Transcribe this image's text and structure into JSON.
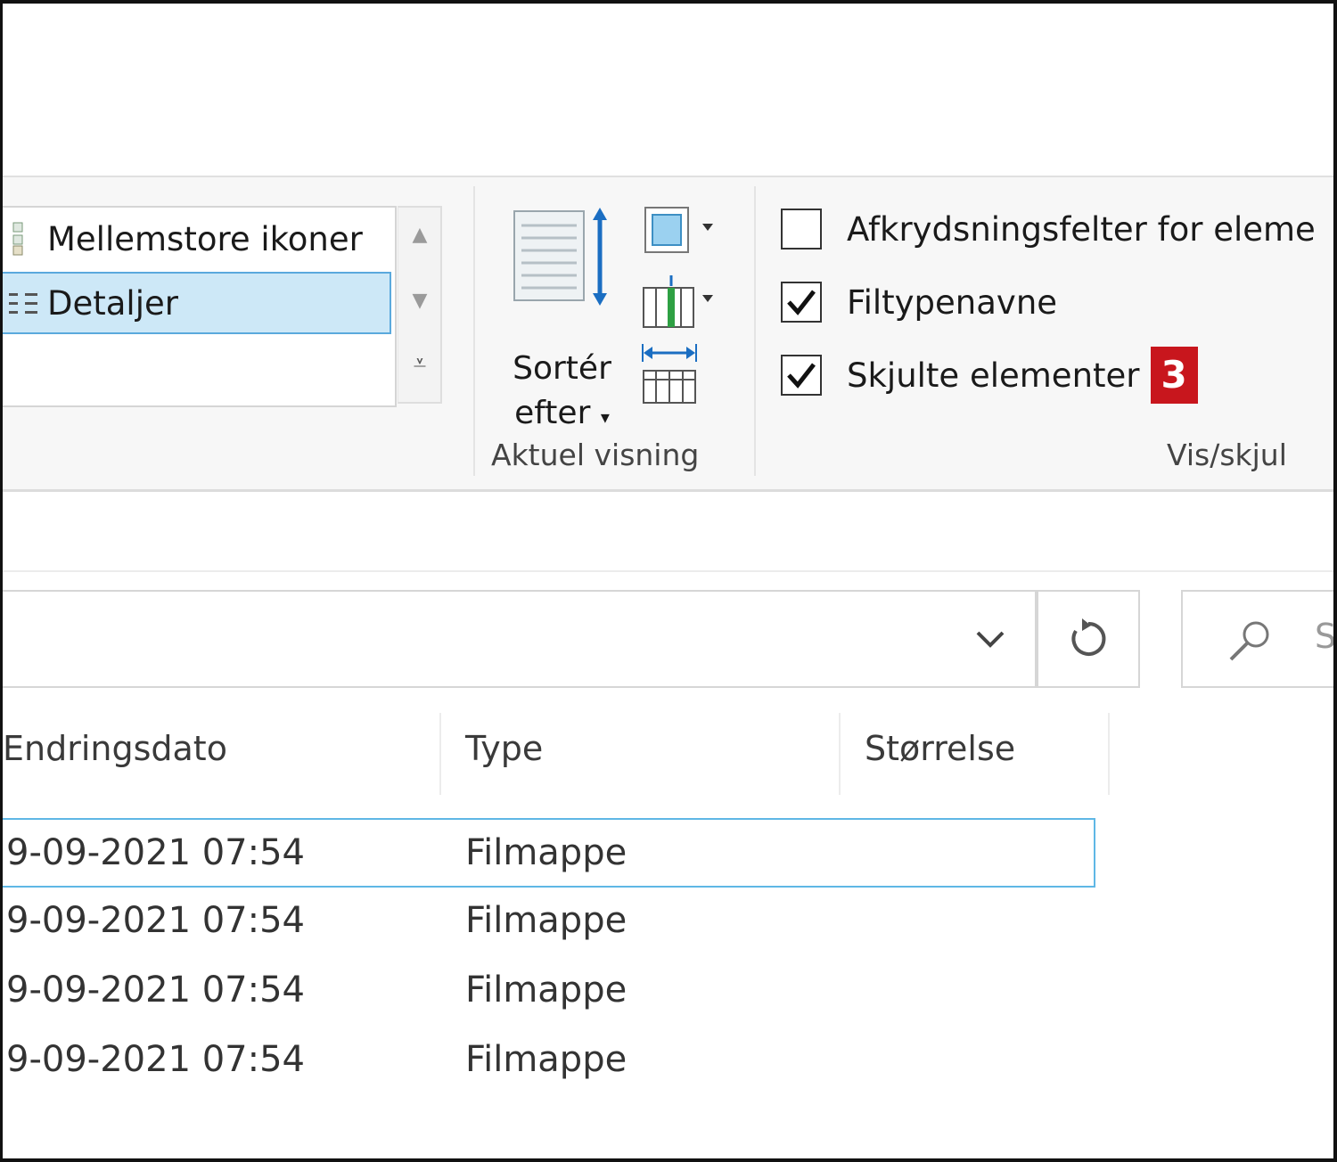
{
  "ribbon": {
    "layout": {
      "items": [
        {
          "label": "Mellemstore ikoner",
          "icon": "medium-icons-icon",
          "selected": false
        },
        {
          "label": "Detaljer",
          "icon": "details-icon",
          "selected": true
        }
      ]
    },
    "current_view": {
      "sort_label_line1": "Sortér",
      "sort_label_line2": "efter",
      "group_label": "Aktuel visning"
    },
    "show_hide": {
      "checkboxes": [
        {
          "label": "Afkrydsningsfelter for eleme",
          "checked": false
        },
        {
          "label": "Filtypenavne",
          "checked": true
        },
        {
          "label": "Skjulte elementer",
          "checked": true
        }
      ],
      "badge": "3",
      "group_label": "Vis/skjul"
    }
  },
  "search": {
    "placeholder_partial": "S"
  },
  "file_list": {
    "columns": [
      "Endringsdato",
      "Type",
      "Størrelse"
    ],
    "rows": [
      {
        "date": "9-09-2021 07:54",
        "type": "Filmappe",
        "size": ""
      },
      {
        "date": "9-09-2021 07:54",
        "type": "Filmappe",
        "size": ""
      },
      {
        "date": "9-09-2021 07:54",
        "type": "Filmappe",
        "size": ""
      },
      {
        "date": "9-09-2021 07:54",
        "type": "Filmappe",
        "size": ""
      }
    ]
  },
  "colors": {
    "accent_blue": "#5aa9dd",
    "selection_bg": "#cde8f7",
    "badge_red": "#c8161d"
  }
}
